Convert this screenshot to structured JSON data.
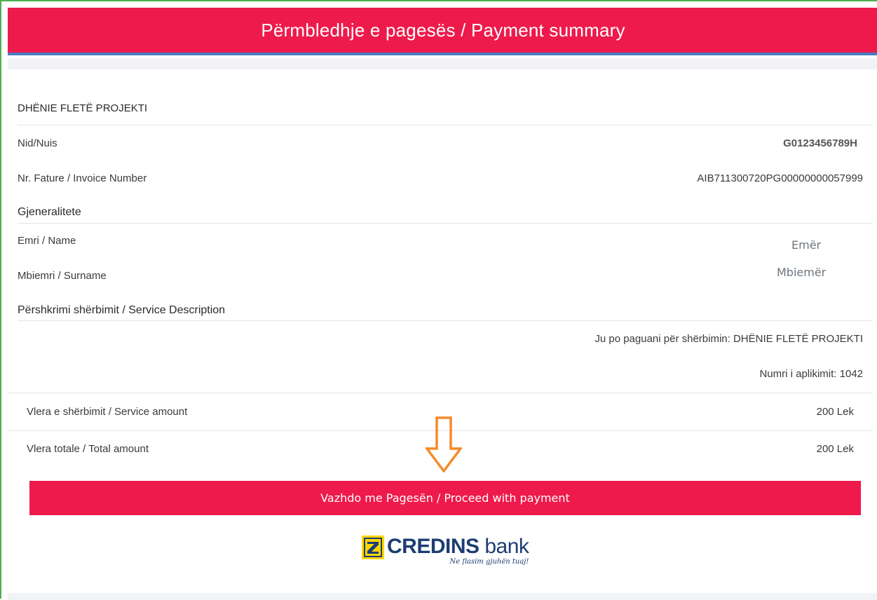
{
  "header": {
    "title": "Përmbledhje e pagesës / Payment summary"
  },
  "service": {
    "title": "DHËNIE FLETË PROJEKTI"
  },
  "details": {
    "nid_label": "Nid/Nuis",
    "nid_value": "G0123456789H",
    "invoice_label": "Nr. Fature / Invoice Number",
    "invoice_value": "AIB711300720PG00000000057999"
  },
  "personal": {
    "section_title": "Gjeneralitete",
    "name_label": "Emri / Name",
    "name_placeholder": "Emër",
    "surname_label": "Mbiemri / Surname",
    "surname_placeholder": "Mbiemër"
  },
  "description": {
    "section_title": "Përshkrimi shërbimit / Service Description",
    "line1": "Ju po paguani për shërbimin: DHËNIE FLETË PROJEKTI",
    "line2": "Numri i aplikimit: 1042"
  },
  "amounts": {
    "service_label": "Vlera e shërbimit / Service amount",
    "service_value": "200 Lek",
    "total_label": "Vlera totale / Total amount",
    "total_value": "200 Lek"
  },
  "actions": {
    "proceed_label": "Vazhdo me Pagesën / Proceed with payment"
  },
  "logo": {
    "brand_bold": "CREDINS",
    "brand_light": "bank",
    "slogan": "Ne flasim gjuhën tuaj!"
  },
  "colors": {
    "accent": "#ee1a4b",
    "header_border": "#4a7cc4",
    "arrow": "#f58a2a",
    "logo_blue": "#1d3d73",
    "logo_yellow": "#ffd600"
  },
  "icons": {
    "arrow": "arrow-down-icon",
    "logo": "credins-logo-icon"
  }
}
